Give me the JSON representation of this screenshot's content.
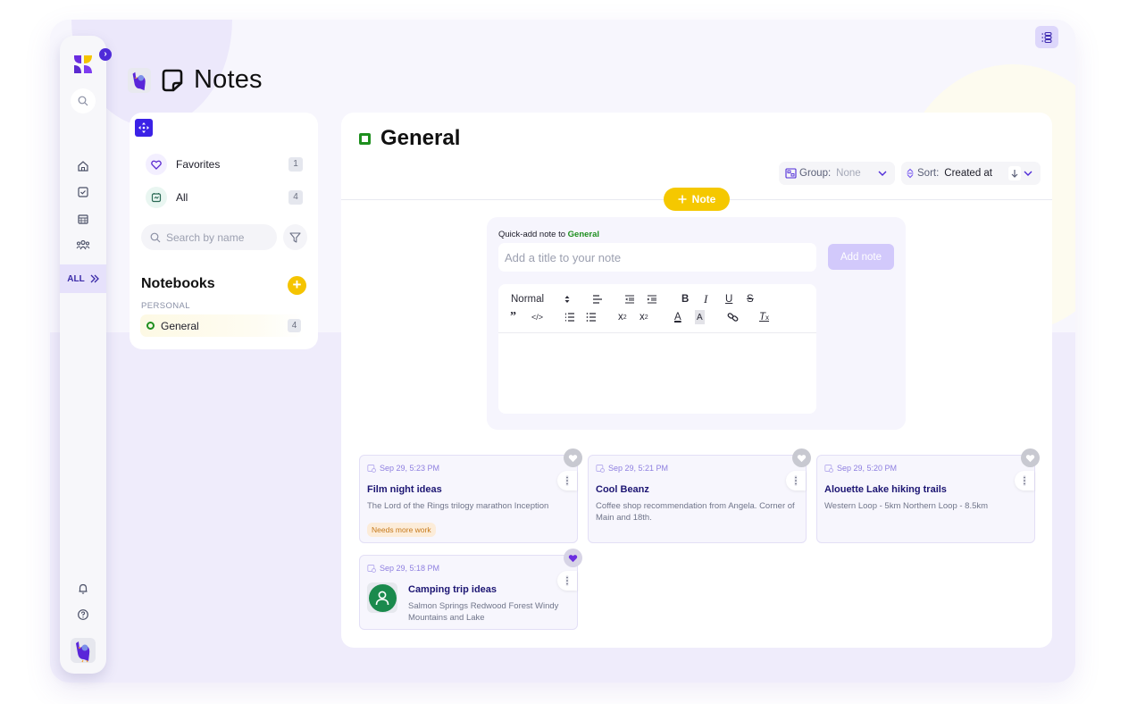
{
  "app": {
    "page_title": "Notes",
    "rail": {
      "expand_icon": "chevron-right-icon",
      "all_label": "ALL",
      "items": [
        {
          "name": "home",
          "icon": "home-icon"
        },
        {
          "name": "tasks",
          "icon": "checkbox-icon"
        },
        {
          "name": "calendar",
          "icon": "calendar-icon"
        },
        {
          "name": "team",
          "icon": "people-icon"
        }
      ],
      "bottom": [
        {
          "name": "notifications",
          "icon": "bell-icon"
        },
        {
          "name": "help",
          "icon": "help-icon"
        }
      ]
    }
  },
  "sidebar": {
    "quick_links": [
      {
        "label": "Favorites",
        "count": "1",
        "icon": "heart-icon"
      },
      {
        "label": "All",
        "count": "4",
        "icon": "notes-stack-icon"
      }
    ],
    "search": {
      "placeholder": "Search by name",
      "value": ""
    },
    "notebooks_title": "Notebooks",
    "section_label": "PERSONAL",
    "notebooks": [
      {
        "name": "General",
        "count": "4",
        "color": "#1e8f1e"
      }
    ]
  },
  "main": {
    "notebook_title": "General",
    "notebook_color": "#1e8f1e",
    "group": {
      "label": "Group:",
      "value": "None"
    },
    "sort": {
      "label": "Sort:",
      "value": "Created at",
      "direction": "descending"
    },
    "add_note_label": "Note",
    "quick_add": {
      "prefix": "Quick-add note to",
      "notebook": "General",
      "title_placeholder": "Add a title to your note",
      "title_value": "",
      "submit_label": "Add note",
      "toolbar": {
        "heading_select": "Normal",
        "buttons": [
          "align",
          "outdent",
          "indent",
          "bold",
          "italic",
          "underline",
          "strike",
          "blockquote",
          "code-block",
          "ordered-list",
          "bullet-list",
          "subscript",
          "superscript",
          "text-color",
          "background-color",
          "link",
          "clear-format"
        ]
      }
    },
    "notes": [
      {
        "date": "Sep 29, 5:23 PM",
        "title": "Film night ideas",
        "body": "The Lord of the Rings trilogy marathon Inception",
        "tag": "Needs more work",
        "favorite": false
      },
      {
        "date": "Sep 29, 5:21 PM",
        "title": "Cool Beanz",
        "body": "Coffee shop recommendation from Angela. Corner of Main and 18th.",
        "tag": null,
        "favorite": false
      },
      {
        "date": "Sep 29, 5:20 PM",
        "title": "Alouette Lake hiking trails",
        "body": "Western Loop - 5km Northern Loop - 8.5km",
        "tag": null,
        "favorite": false
      },
      {
        "date": "Sep 29, 5:18 PM",
        "title": "Camping trip ideas",
        "body": "Salmon Springs Redwood Forest Windy Mountains and Lake",
        "tag": null,
        "favorite": true,
        "has_avatar": true
      }
    ]
  },
  "colors": {
    "accent": "#4f2bd8",
    "yellow": "#f5c800",
    "notebook_green": "#1e8f1e",
    "note_title": "#1d1673",
    "date_purple": "#8e7fe0"
  }
}
